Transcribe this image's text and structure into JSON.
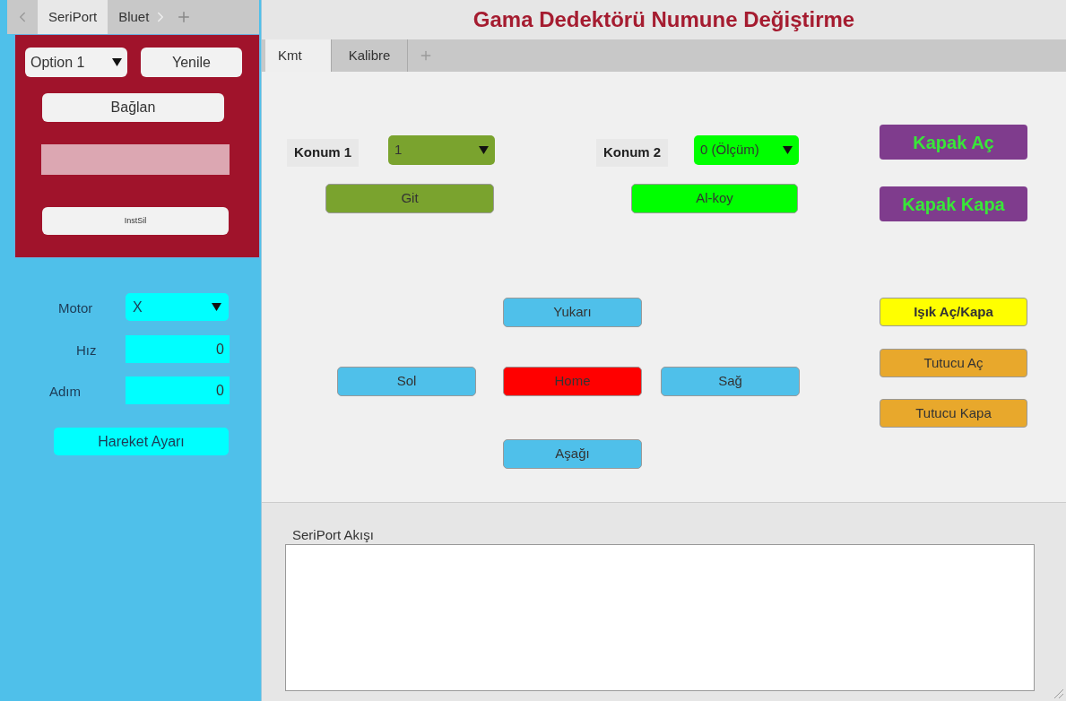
{
  "left_tabs": [
    {
      "label": "SeriPort",
      "selected": true
    },
    {
      "label": "Bluet",
      "selected": false
    }
  ],
  "connection": {
    "port_select": "Option 1",
    "refresh_button": "Yenile",
    "connect_button": "Bağlan",
    "clear_button": "InstSil"
  },
  "motor": {
    "fields": [
      {
        "kind": "select",
        "label": "Motor",
        "value": "X"
      },
      {
        "kind": "input",
        "label": "Hız",
        "value": "0"
      },
      {
        "kind": "input",
        "label": "Adım",
        "value": "0"
      }
    ],
    "apply_button": "Hareket Ayarı"
  },
  "title": "Gama Dedektörü Numune Değiştirme",
  "tabs": [
    {
      "label": "Kmt",
      "selected": true
    },
    {
      "label": "Kalibre",
      "selected": false
    }
  ],
  "positions": [
    {
      "label": "Konum 1",
      "value": "1",
      "button": "Git",
      "color": "#7aa32e"
    },
    {
      "label": "Konum 2",
      "value": "0 (Ölçüm)",
      "button": "Al-koy",
      "color": "#00ff00"
    }
  ],
  "cover_buttons": [
    {
      "label": "Kapak Aç"
    },
    {
      "label": "Kapak Kapa"
    }
  ],
  "direction_buttons": [
    {
      "label": "Yukarı",
      "color": "#4fc0ea"
    },
    {
      "label": "Sol",
      "color": "#4fc0ea"
    },
    {
      "label": "Home",
      "color": "#ff0000"
    },
    {
      "label": "Sağ",
      "color": "#4fc0ea"
    },
    {
      "label": "Aşağı",
      "color": "#4fc0ea"
    }
  ],
  "side_buttons": [
    {
      "label": "Işık Aç/Kapa",
      "color": "#ffff00"
    },
    {
      "label": "Tutucu Aç",
      "color": "#e8a82c"
    },
    {
      "label": "Tutucu Kapa",
      "color": "#e8a82c"
    }
  ],
  "log": {
    "label": "SeriPort Akışı"
  }
}
